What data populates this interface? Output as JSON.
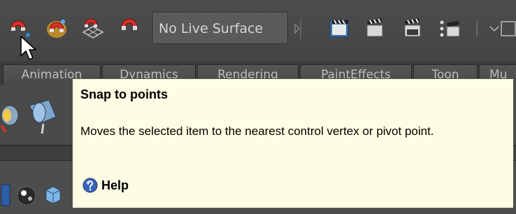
{
  "status_line": {
    "tools": [
      {
        "id": "snap-to-grids",
        "icon": "magnet-grid-icon"
      },
      {
        "id": "snap-to-curves",
        "icon": "magnet-curve-icon"
      },
      {
        "id": "snap-to-points",
        "icon": "magnet-point-icon"
      },
      {
        "id": "snap-to-view-planes",
        "icon": "magnet-plane-icon"
      },
      {
        "id": "make-live",
        "icon": "magnet-icon"
      }
    ],
    "live_surface_label": "No Live Surface",
    "render_icons": [
      "render-current-frame-icon",
      "ipr-render-icon",
      "render-settings-icon",
      "hypershade-icon"
    ]
  },
  "shelf": {
    "tabs": [
      "Animation",
      "Dynamics",
      "Rendering",
      "PaintEffects",
      "Toon",
      "Mu"
    ]
  },
  "tooltip": {
    "title": "Snap to points",
    "description": "Moves the selected item to the nearest control vertex or pivot point.",
    "help_label": "Help"
  },
  "colors": {
    "tooltip_bg": "#fdfde3",
    "toolbar_bg": "#444444",
    "magnet_red": "#d8312b"
  }
}
